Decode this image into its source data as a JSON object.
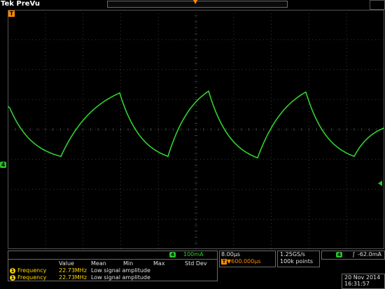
{
  "header": {
    "brand": "Tek",
    "mode": "PreVu"
  },
  "markers": {
    "trigger_position": "T",
    "channel_marker": "4"
  },
  "channel": {
    "number": "4",
    "scale": "100mA"
  },
  "horizontal": {
    "timebase": "8.00µs",
    "trigger_offset": "▼600.000µs"
  },
  "acquisition": {
    "sample_rate": "1.25GS/s",
    "record_length": "100k points"
  },
  "trigger": {
    "source": "4",
    "slope_symbol": "ʃ",
    "level": "-62.0mA"
  },
  "datetime": {
    "date": "20 Nov 2014",
    "time": "16:31:57"
  },
  "measurements": {
    "headers": [
      "Value",
      "Mean",
      "Min",
      "Max",
      "Std Dev"
    ],
    "rows": [
      {
        "source": "1",
        "name": "Frequency",
        "value": "22.73MHz",
        "status": "Low signal amplitude"
      },
      {
        "source": "1",
        "name": "Frequency",
        "value": "22.73MHz",
        "status": "Low signal amplitude"
      }
    ]
  },
  "colors": {
    "trace": "#2fd12f",
    "grid": "#3a3a3a",
    "accent": "#ff8c00",
    "measure": "#ffd800"
  },
  "waveform": {
    "peaks_div": [
      0.72,
      1.3,
      1.3,
      1.3,
      1.3
    ],
    "troughs_div": [
      -0.9,
      -0.9,
      -0.95,
      -0.9
    ],
    "period_div": 2.53,
    "description_free": true
  }
}
